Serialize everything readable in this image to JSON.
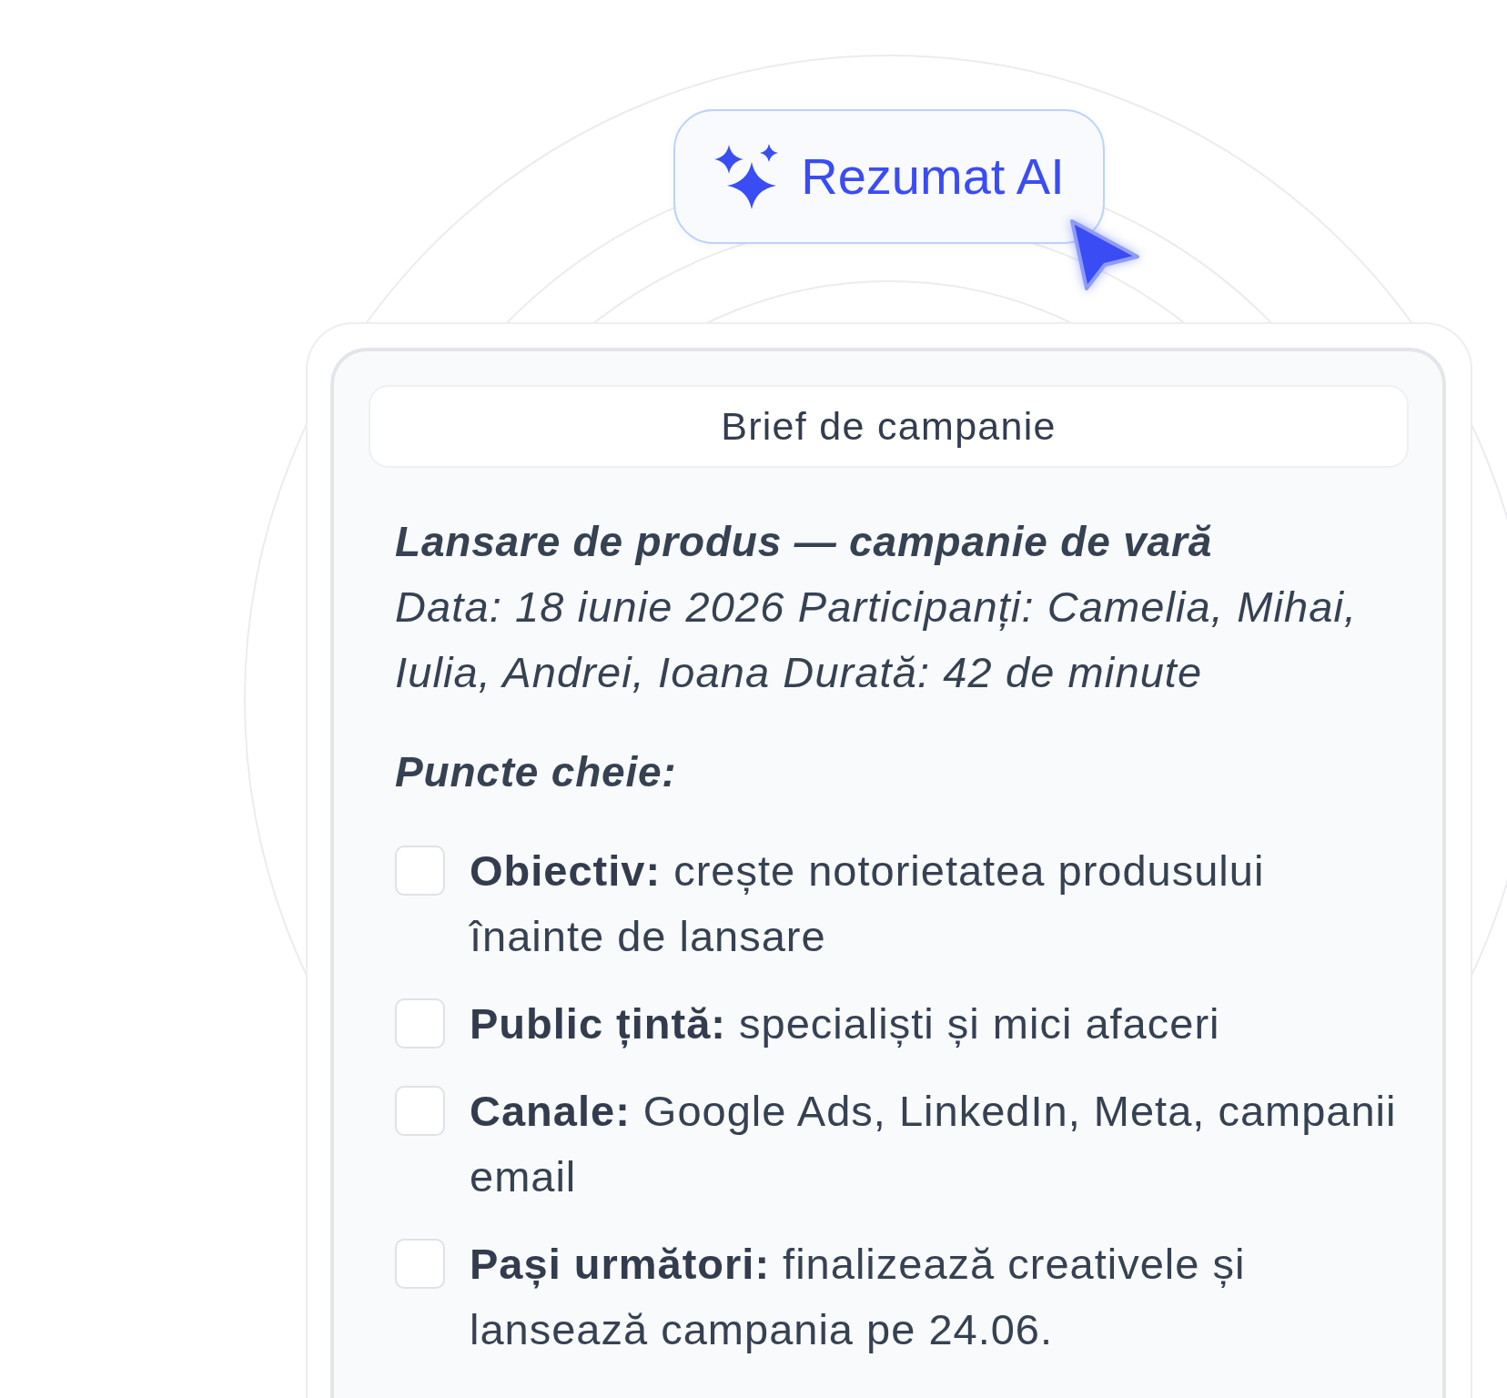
{
  "ai_button": {
    "label": "Rezumat AI"
  },
  "brief": {
    "title": "Brief de campanie",
    "heading": "Lansare de produs — campanie de vară",
    "meta": "Data: 18 iunie 2026 Participanți: Camelia, Mihai, Iulia, Andrei, Ioana Durată: 42 de minute",
    "section_title": "Puncte cheie:",
    "items": [
      {
        "text": "**Obiectiv:** crește notorietatea produsului înainte de lansare",
        "checked": false
      },
      {
        "text": "**Public țintă:** specialiști și mici afaceri",
        "checked": false
      },
      {
        "text": "**Canale:** Google Ads, LinkedIn, Meta, campanii email",
        "checked": false
      },
      {
        "text": "**Pași următori:** finalizează creativele și lansează campania pe 24.06.",
        "checked": false
      }
    ]
  }
}
